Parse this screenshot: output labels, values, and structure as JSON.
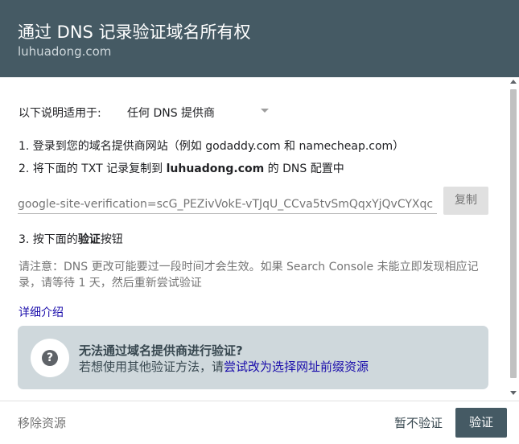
{
  "header": {
    "title": "通过 DNS 记录验证域名所有权",
    "subtitle": "luhuadong.com"
  },
  "provider": {
    "label": "以下说明适用于:",
    "selected": "任何 DNS 提供商"
  },
  "steps": {
    "step1": "1. 登录到您的域名提供商网站（例如 godaddy.com 和 namecheap.com）",
    "step2_prefix": "2. 将下面的 TXT 记录复制到 ",
    "step2_domain": "luhuadong.com",
    "step2_suffix": " 的 DNS 配置中",
    "step3_prefix": "3. 按下面的",
    "step3_bold": "验证",
    "step3_suffix": "按钮"
  },
  "record": {
    "value": "google-site-verification=scG_PEZivVokE-vTJqU_CCva5tvSmQqxYjQvCYXqc",
    "copy_label": "复制"
  },
  "note": "请注意：DNS 更改可能要过一段时间才会生效。如果 Search Console 未能立即发现相应记录，请等待 1 天，然后重新尝试验证",
  "more_link": "详细介绍",
  "help": {
    "icon_glyph": "?",
    "title": "无法通过域名提供商进行验证?",
    "desc_prefix": "若想使用其他验证方法，请",
    "desc_link": "尝试改为选择网址前缀资源"
  },
  "footer": {
    "remove": "移除资源",
    "later": "暂不验证",
    "verify": "验证"
  },
  "colors": {
    "header_bg": "#455a64",
    "link": "#1a0dab",
    "help_bg": "#cfd8dc",
    "primary_button": "#455a64"
  },
  "icons": {
    "help": "help-circle-icon",
    "dropdown": "chevron-down-icon"
  }
}
